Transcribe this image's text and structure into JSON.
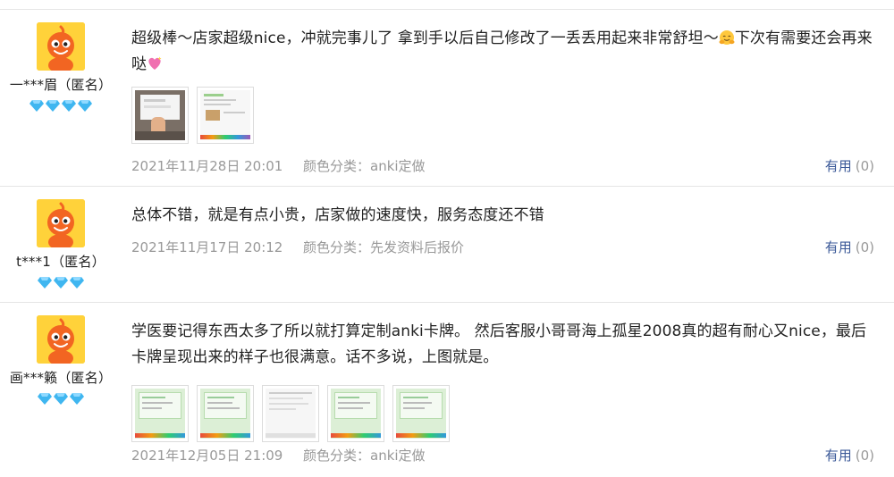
{
  "reviews": [
    {
      "nickname": "一***眉（匿名）",
      "gem_count": 4,
      "text_before_emoji": "超级棒～店家超级nice，冲就完事儿了 拿到手以后自己修改了一丢丢用起来非常舒坦～",
      "text_after_emoji": "下次有需要还会再来哒",
      "emoji_1": "hugging-face-emoji",
      "emoji_2": "sparkling-heart-emoji",
      "thumb_count": 2,
      "date": "2021年11月28日 20:01",
      "color_category": "颜色分类：anki定做",
      "useful_label": "有用",
      "useful_count": "(0)"
    },
    {
      "nickname": "t***1（匿名）",
      "gem_count": 3,
      "text": "总体不错，就是有点小贵，店家做的速度快，服务态度还不错",
      "date": "2021年11月17日 20:12",
      "color_category": "颜色分类：先发资料后报价",
      "useful_label": "有用",
      "useful_count": "(0)"
    },
    {
      "nickname": "画***籁（匿名）",
      "gem_count": 3,
      "text": "学医要记得东西太多了所以就打算定制anki卡牌。 然后客服小哥哥海上孤星2008真的超有耐心又nice，最后卡牌呈现出来的样子也很满意。话不多说，上图就是。",
      "thumb_count": 5,
      "date": "2021年12月05日 21:09",
      "color_category": "颜色分类：anki定做",
      "useful_label": "有用",
      "useful_count": "(0)"
    }
  ],
  "colors": {
    "avatar_bg": "#ffd23a",
    "avatar_figure": "#f26522",
    "gem": "#3fb6f0",
    "useful_link": "#3b5998",
    "meta_text": "#999999",
    "divider": "#e5e5e5"
  }
}
